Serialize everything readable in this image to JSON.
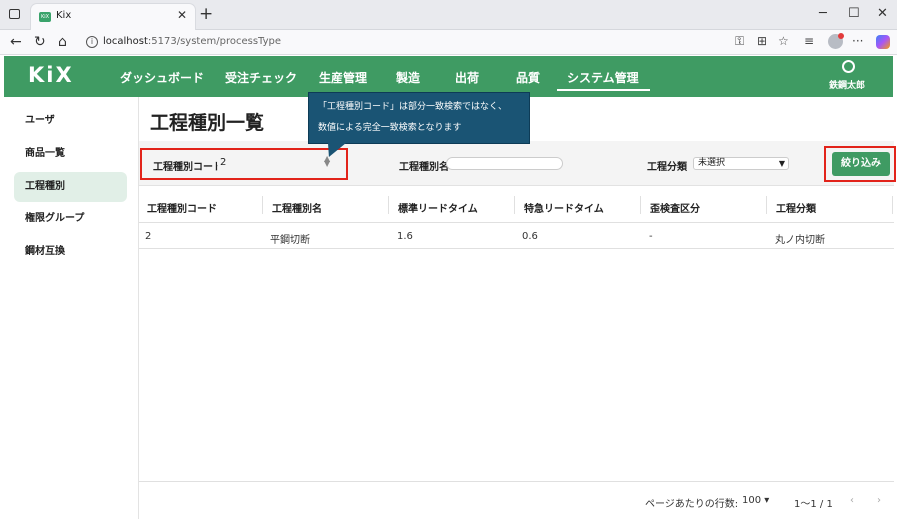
{
  "browser": {
    "tab_title": "Kix",
    "tab_favicon": "KiX",
    "new_tab_icon": "+",
    "tab_close_icon": "✕",
    "url_host": "localhost",
    "url_path": ":5173/system/processType",
    "win_minimize": "─",
    "win_maximize": "☐",
    "win_close": "✕"
  },
  "header": {
    "logo": "KiX",
    "nav": [
      "ダッシュボード",
      "受注チェック",
      "生産管理",
      "製造",
      "出荷",
      "品質",
      "システム管理"
    ],
    "active_nav_index": 6,
    "user_name": "鉄鋼太郎",
    "accent_color": "#3f9b63"
  },
  "sidebar": {
    "items": [
      "ユーザ",
      "商品一覧",
      "工程種別",
      "権限グループ",
      "鋼材互換"
    ],
    "active_index": 2
  },
  "main": {
    "title": "工程種別一覧",
    "filters": {
      "code_label": "工程種別コード",
      "code_value": "2",
      "name_label": "工程種別名",
      "name_value": "",
      "category_label": "工程分類",
      "category_value": "未選択",
      "button_label": "絞り込み"
    },
    "table": {
      "columns": [
        "工程種別コード",
        "工程種別名",
        "標準リードタイム",
        "特急リードタイム",
        "歪検査区分",
        "工程分類"
      ],
      "rows": [
        [
          "2",
          "平鋼切断",
          "1.6",
          "0.6",
          "-",
          "丸ノ内切断"
        ]
      ]
    },
    "pagination": {
      "rows_per_page_label": "ページあたりの行数:",
      "rows_per_page_value": "100",
      "range": "1〜1 / 1"
    }
  },
  "callout": {
    "line1": "「工程種別コード」は部分一致検索ではなく、",
    "line2": "数値による完全一致検索となります"
  }
}
